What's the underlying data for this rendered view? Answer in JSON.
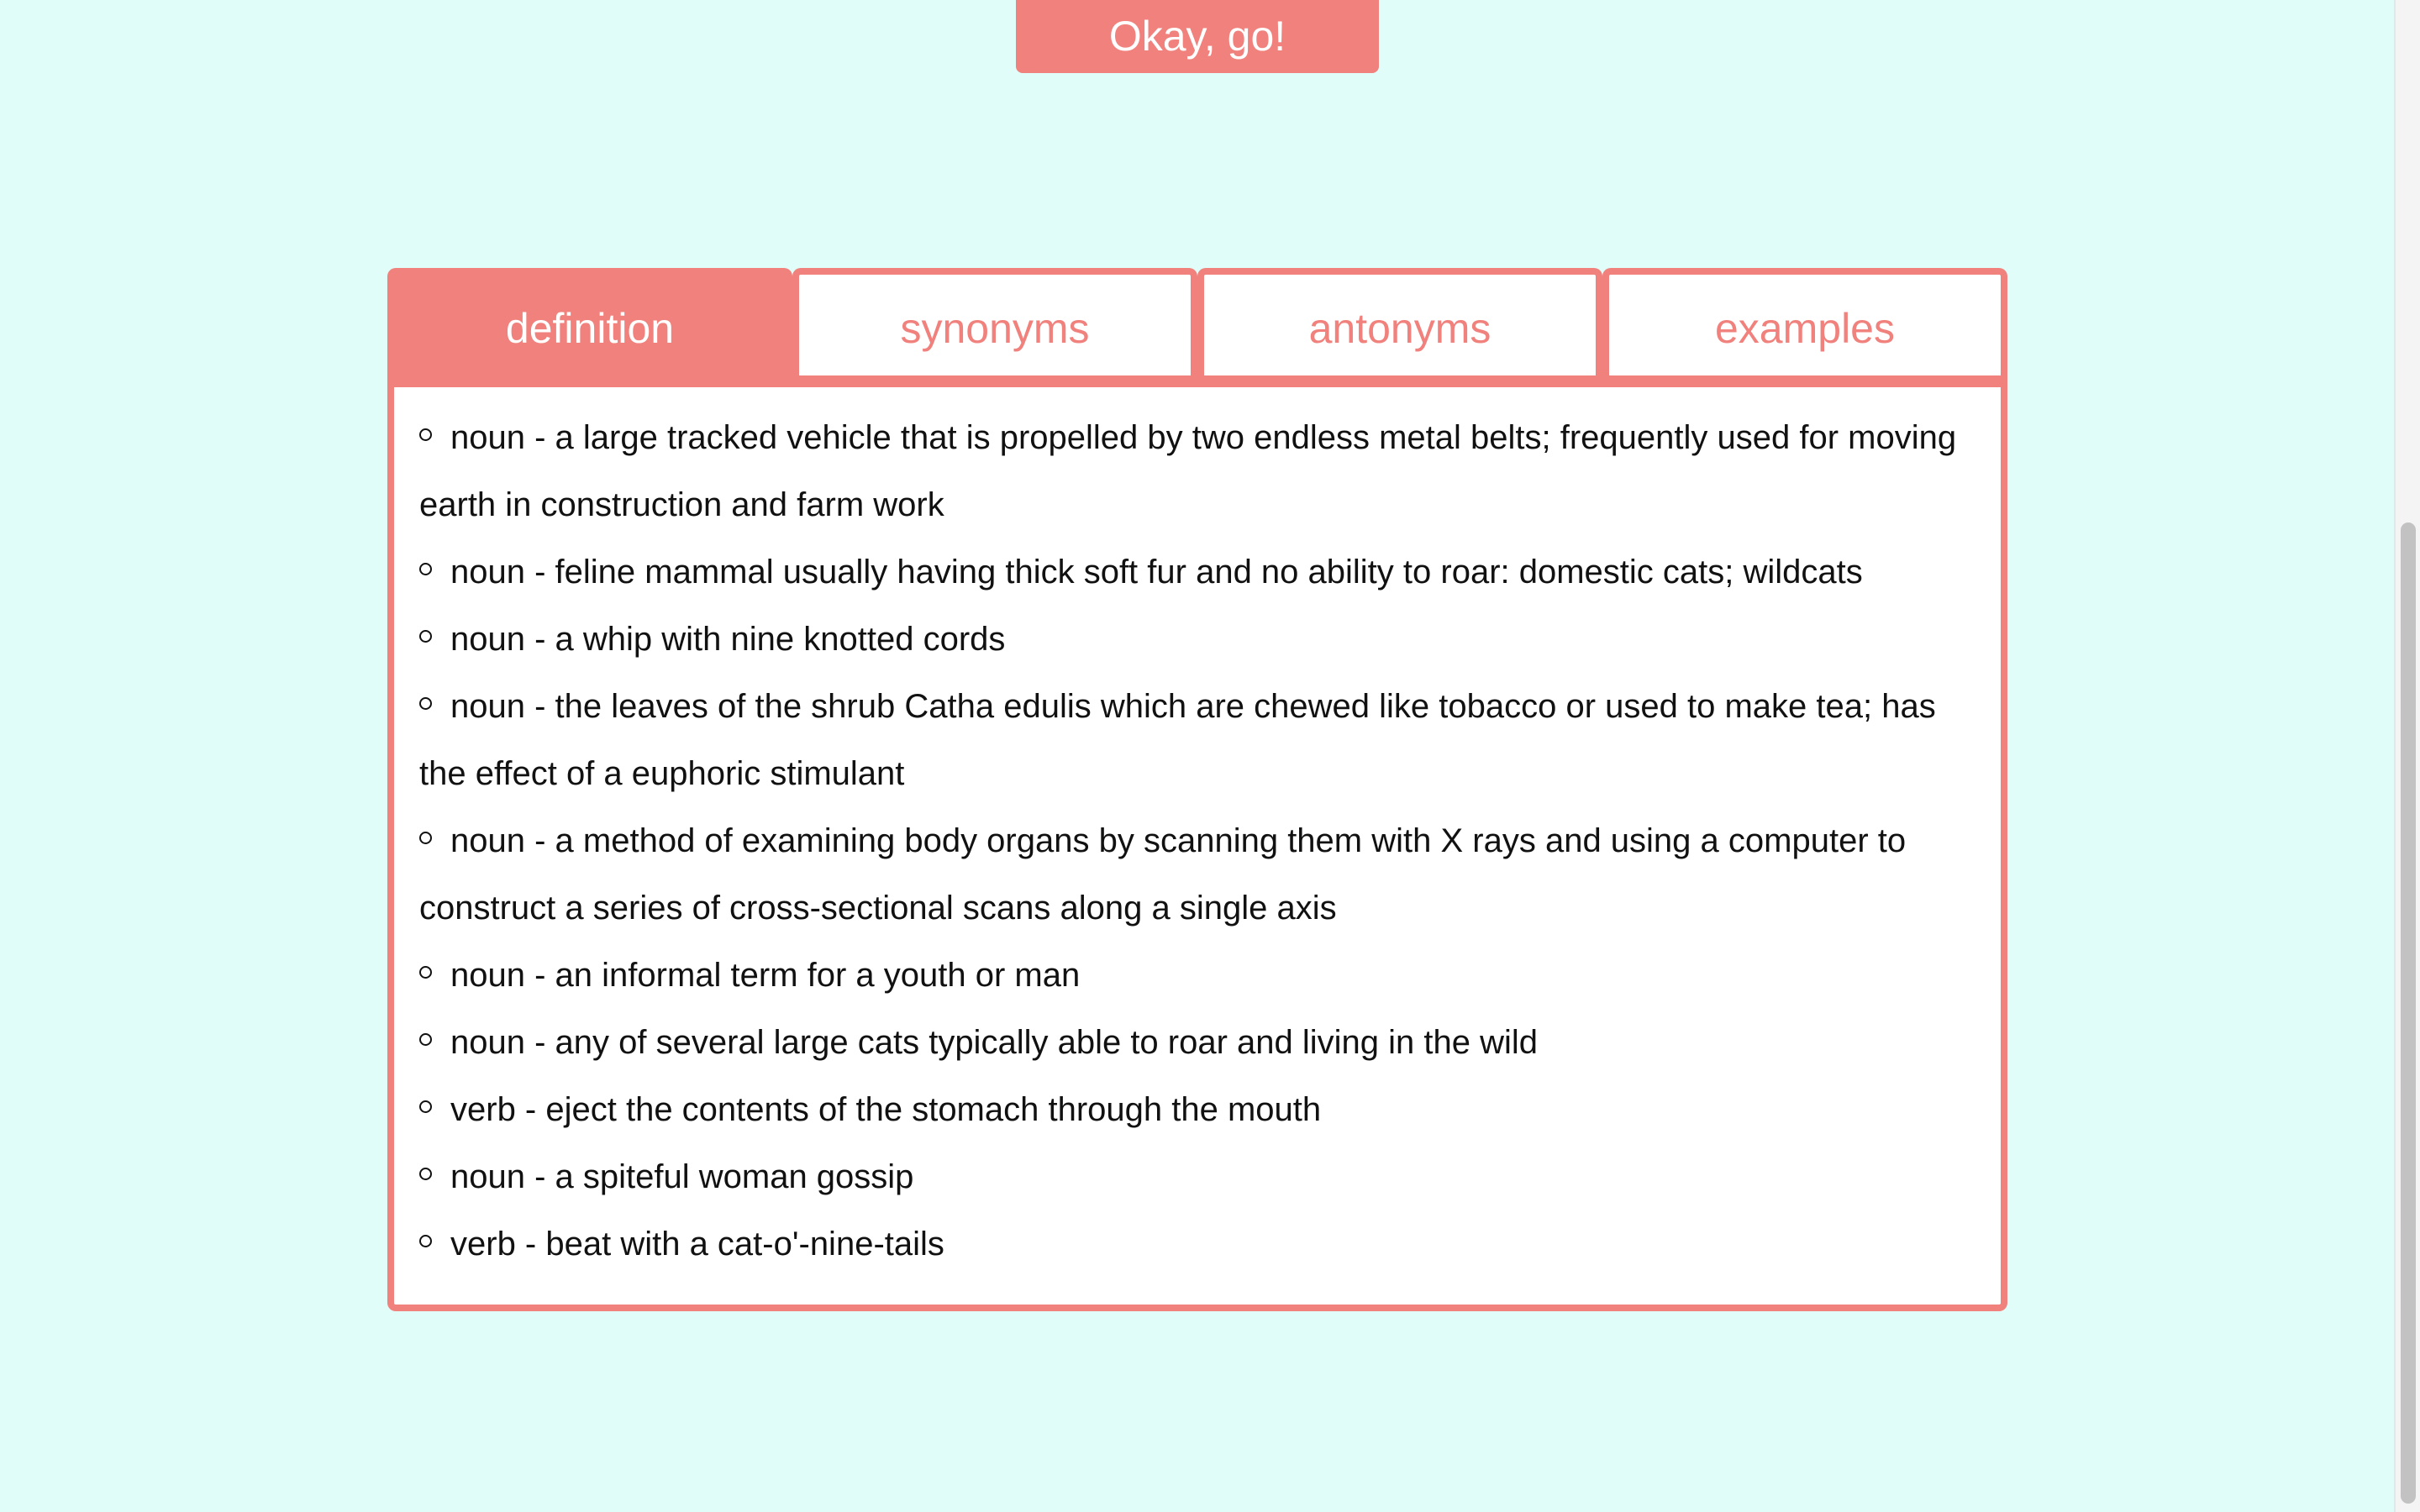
{
  "go_button": {
    "label": "Okay, go!"
  },
  "tabs": [
    {
      "label": "definition",
      "active": true
    },
    {
      "label": "synonyms",
      "active": false
    },
    {
      "label": "antonyms",
      "active": false
    },
    {
      "label": "examples",
      "active": false
    }
  ],
  "definitions": [
    "noun - a large tracked vehicle that is propelled by two endless metal belts; frequently used for moving earth in construction and farm work",
    "noun - feline mammal usually having thick soft fur and no ability to roar: domestic cats; wildcats",
    "noun - a whip with nine knotted cords",
    "noun - the leaves of the shrub Catha edulis which are chewed like tobacco or used to make tea; has the effect of a euphoric stimulant",
    "noun - a method of examining body organs by scanning them with X rays and using a computer to construct a series of cross-sectional scans along a single axis",
    "noun - an informal term for a youth or man",
    "noun - any of several large cats typically able to roar and living in the wild",
    "verb - eject the contents of the stomach through the mouth",
    "noun - a spiteful woman gossip",
    "verb - beat with a cat-o'-nine-tails"
  ],
  "colors": {
    "background": "#e1fdf9",
    "accent": "#f0817c",
    "panel": "#ffffff",
    "text": "#111111"
  }
}
